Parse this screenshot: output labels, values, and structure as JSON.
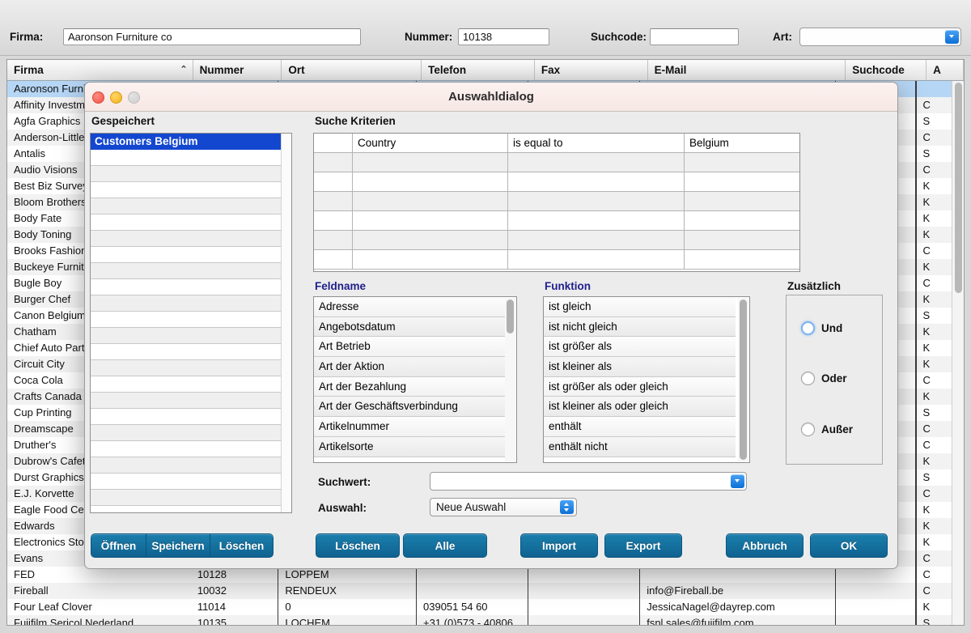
{
  "toolbar": {
    "firma_label": "Firma:",
    "firma_value": "Aaronson Furniture co",
    "nummer_label": "Nummer:",
    "nummer_value": "10138",
    "suchcode_label": "Suchcode:",
    "suchcode_value": "",
    "art_label": "Art:",
    "art_value": ""
  },
  "table": {
    "columns": [
      "Firma",
      "Nummer",
      "Ort",
      "Telefon",
      "Fax",
      "E-Mail",
      "Suchcode",
      "A"
    ],
    "sort_column": "Firma",
    "sort_caret": "⌃",
    "rows": [
      {
        "firma": "Aaronson Furniture co",
        "nummer": "",
        "ort": "",
        "telefon": "",
        "fax": "",
        "email": "",
        "suchcode": "",
        "a": "",
        "selected": true
      },
      {
        "firma": "Affinity Investments",
        "nummer": "",
        "ort": "",
        "telefon": "",
        "fax": "",
        "email": "",
        "suchcode": "",
        "a": "C"
      },
      {
        "firma": "Agfa Graphics",
        "nummer": "",
        "ort": "",
        "telefon": "",
        "fax": "",
        "email": "",
        "suchcode": "",
        "a": "S"
      },
      {
        "firma": "Anderson-Little",
        "nummer": "",
        "ort": "",
        "telefon": "",
        "fax": "",
        "email": "",
        "suchcode": "",
        "a": "C"
      },
      {
        "firma": "Antalis",
        "nummer": "",
        "ort": "",
        "telefon": "",
        "fax": "",
        "email": "",
        "suchcode": "",
        "a": "S"
      },
      {
        "firma": "Audio Visions",
        "nummer": "",
        "ort": "",
        "telefon": "",
        "fax": "",
        "email": "",
        "suchcode": "",
        "a": "C"
      },
      {
        "firma": "Best Biz Survey",
        "nummer": "",
        "ort": "",
        "telefon": "",
        "fax": "",
        "email": "",
        "suchcode": "",
        "a": "K"
      },
      {
        "firma": "Bloom Brothers",
        "nummer": "",
        "ort": "",
        "telefon": "",
        "fax": "",
        "email": "",
        "suchcode": "",
        "a": "K"
      },
      {
        "firma": "Body Fate",
        "nummer": "",
        "ort": "",
        "telefon": "",
        "fax": "",
        "email": "",
        "suchcode": "",
        "a": "K"
      },
      {
        "firma": "Body Toning",
        "nummer": "",
        "ort": "",
        "telefon": "",
        "fax": "",
        "email": "",
        "suchcode": "",
        "a": "K"
      },
      {
        "firma": "Brooks Fashion",
        "nummer": "",
        "ort": "",
        "telefon": "",
        "fax": "",
        "email": "",
        "suchcode": "",
        "a": "C"
      },
      {
        "firma": "Buckeye Furniture",
        "nummer": "",
        "ort": "",
        "telefon": "",
        "fax": "",
        "email": "",
        "suchcode": "",
        "a": "K"
      },
      {
        "firma": "Bugle Boy",
        "nummer": "",
        "ort": "",
        "telefon": "",
        "fax": "",
        "email": "",
        "suchcode": "",
        "a": "C"
      },
      {
        "firma": "Burger Chef",
        "nummer": "",
        "ort": "",
        "telefon": "",
        "fax": "",
        "email": "",
        "suchcode": "",
        "a": "K"
      },
      {
        "firma": "Canon Belgium",
        "nummer": "",
        "ort": "",
        "telefon": "",
        "fax": "",
        "email": "",
        "suchcode": "",
        "a": "S"
      },
      {
        "firma": "Chatham",
        "nummer": "",
        "ort": "",
        "telefon": "",
        "fax": "",
        "email": "",
        "suchcode": "",
        "a": "K"
      },
      {
        "firma": "Chief Auto Parts",
        "nummer": "",
        "ort": "",
        "telefon": "",
        "fax": "",
        "email": "",
        "suchcode": "",
        "a": "K"
      },
      {
        "firma": "Circuit City",
        "nummer": "",
        "ort": "",
        "telefon": "",
        "fax": "",
        "email": "",
        "suchcode": "",
        "a": "K"
      },
      {
        "firma": "Coca Cola",
        "nummer": "",
        "ort": "",
        "telefon": "",
        "fax": "",
        "email": "",
        "suchcode": "",
        "a": "C"
      },
      {
        "firma": "Crafts Canada",
        "nummer": "",
        "ort": "",
        "telefon": "",
        "fax": "",
        "email": "",
        "suchcode": "",
        "a": "K"
      },
      {
        "firma": "Cup Printing",
        "nummer": "",
        "ort": "",
        "telefon": "",
        "fax": "",
        "email": "",
        "suchcode": "",
        "a": "S"
      },
      {
        "firma": "Dreamscape",
        "nummer": "",
        "ort": "",
        "telefon": "",
        "fax": "",
        "email": "",
        "suchcode": "",
        "a": "C"
      },
      {
        "firma": "Druther's",
        "nummer": "",
        "ort": "",
        "telefon": "",
        "fax": "",
        "email": "",
        "suchcode": "",
        "a": "C"
      },
      {
        "firma": "Dubrow's Cafeteria",
        "nummer": "",
        "ort": "",
        "telefon": "",
        "fax": "",
        "email": "",
        "suchcode": "",
        "a": "K"
      },
      {
        "firma": "Durst Graphics",
        "nummer": "",
        "ort": "",
        "telefon": "",
        "fax": "",
        "email": "",
        "suchcode": "",
        "a": "S"
      },
      {
        "firma": "E.J. Korvette",
        "nummer": "",
        "ort": "",
        "telefon": "",
        "fax": "",
        "email": "",
        "suchcode": "",
        "a": "C"
      },
      {
        "firma": "Eagle Food Centers",
        "nummer": "",
        "ort": "",
        "telefon": "",
        "fax": "",
        "email": "",
        "suchcode": "",
        "a": "K"
      },
      {
        "firma": "Edwards",
        "nummer": "",
        "ort": "",
        "telefon": "",
        "fax": "",
        "email": "",
        "suchcode": "",
        "a": "K"
      },
      {
        "firma": "Electronics Store",
        "nummer": "",
        "ort": "",
        "telefon": "",
        "fax": "",
        "email": "",
        "suchcode": "",
        "a": "K"
      },
      {
        "firma": "Evans",
        "nummer": "",
        "ort": "",
        "telefon": "",
        "fax": "",
        "email": "",
        "suchcode": "",
        "a": "C"
      },
      {
        "firma": "FED",
        "nummer": "10128",
        "ort": "LOPPEM",
        "telefon": "",
        "fax": "",
        "email": "",
        "suchcode": "",
        "a": "C"
      },
      {
        "firma": "Fireball",
        "nummer": "10032",
        "ort": "RENDEUX",
        "telefon": "",
        "fax": "",
        "email": "info@Fireball.be",
        "suchcode": "",
        "a": "C"
      },
      {
        "firma": "Four Leaf Clover",
        "nummer": "11014",
        "ort": "0",
        "telefon": "039051 54 60",
        "fax": "",
        "email": "JessicaNagel@dayrep.com",
        "suchcode": "",
        "a": "K"
      },
      {
        "firma": "Fujifilm Sericol Nederland",
        "nummer": "10135",
        "ort": "LOCHEM",
        "telefon": "+31 (0)573 - 40806",
        "fax": "",
        "email": "fsnl.sales@fujifilm.com",
        "suchcode": "",
        "a": "S"
      }
    ]
  },
  "dialog": {
    "title": "Auswahldialog",
    "window_buttons": [
      "close-button",
      "minimize-button",
      "zoom-button"
    ],
    "saved": {
      "label": "Gespeichert",
      "items": [
        "Customers Belgium"
      ],
      "selected_index": 0,
      "empty_rows": 22
    },
    "criteria": {
      "label": "Suche Kriterien",
      "rows": [
        {
          "index": "",
          "field": "Country",
          "function": "is equal to",
          "value": "Belgium"
        },
        {
          "index": "",
          "field": "",
          "function": "",
          "value": ""
        },
        {
          "index": "",
          "field": "",
          "function": "",
          "value": ""
        },
        {
          "index": "",
          "field": "",
          "function": "",
          "value": ""
        },
        {
          "index": "",
          "field": "",
          "function": "",
          "value": ""
        },
        {
          "index": "",
          "field": "",
          "function": "",
          "value": ""
        },
        {
          "index": "",
          "field": "",
          "function": "",
          "value": ""
        }
      ]
    },
    "fieldname": {
      "label": "Feldname",
      "items": [
        "Adresse",
        "Angebotsdatum",
        "Art Betrieb",
        "Art der Aktion",
        "Art der Bezahlung",
        "Art der Geschäftsverbindung",
        "Artikelnummer",
        "Artikelsorte"
      ]
    },
    "funktion": {
      "label": "Funktion",
      "items": [
        "ist gleich",
        "ist nicht gleich",
        "ist größer als",
        "ist kleiner als",
        "ist größer als oder gleich",
        "ist kleiner als oder gleich",
        "enthält",
        "enthält nicht"
      ]
    },
    "zusaetzlich": {
      "label": "Zusätzlich",
      "options": [
        "Und",
        "Oder",
        "Außer"
      ],
      "focused_index": 0,
      "selected_index": -1
    },
    "suchwert": {
      "label": "Suchwert:",
      "value": ""
    },
    "auswahl": {
      "label": "Auswahl:",
      "value": "Neue Auswahl"
    },
    "buttons": {
      "saved_group": [
        "Öffnen",
        "Speichern",
        "Löschen"
      ],
      "criteria_delete": "Löschen",
      "criteria_all": "Alle",
      "import": "Import",
      "export": "Export",
      "cancel": "Abbruch",
      "ok": "OK"
    }
  },
  "colors": {
    "accent_blue": "#1347d0",
    "button_blue": "#0f6290",
    "row_select": "#b6d6f5",
    "label_blue": "#20208c"
  }
}
